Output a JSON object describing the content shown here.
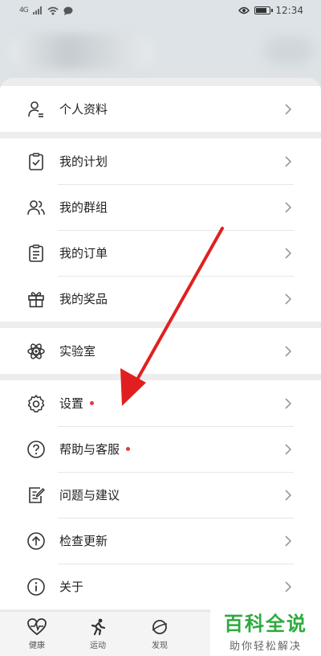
{
  "status_bar": {
    "signal_text": "4G",
    "time": "12:34",
    "icons": [
      "signal-icon",
      "wifi-icon",
      "message-icon",
      "eye-icon",
      "battery-icon"
    ]
  },
  "menu": {
    "group1": [
      {
        "label": "个人资料",
        "icon": "person-icon",
        "dot": false
      }
    ],
    "group2": [
      {
        "label": "我的计划",
        "icon": "clipboard-check-icon",
        "dot": false
      },
      {
        "label": "我的群组",
        "icon": "group-icon",
        "dot": false
      },
      {
        "label": "我的订单",
        "icon": "order-icon",
        "dot": false
      },
      {
        "label": "我的奖品",
        "icon": "gift-icon",
        "dot": false
      }
    ],
    "group3": [
      {
        "label": "实验室",
        "icon": "atom-icon",
        "dot": false
      }
    ],
    "group4": [
      {
        "label": "设置",
        "icon": "gear-icon",
        "dot": true
      },
      {
        "label": "帮助与客服",
        "icon": "help-icon",
        "dot": true
      },
      {
        "label": "问题与建议",
        "icon": "feedback-icon",
        "dot": false
      },
      {
        "label": "检查更新",
        "icon": "update-icon",
        "dot": false
      },
      {
        "label": "关于",
        "icon": "info-icon",
        "dot": false
      }
    ]
  },
  "tabs": [
    {
      "label": "健康",
      "icon": "heart-pulse-icon"
    },
    {
      "label": "运动",
      "icon": "runner-icon"
    },
    {
      "label": "发现",
      "icon": "planet-icon"
    }
  ],
  "watermark": {
    "title": "百科全说",
    "subtitle": "助你轻松解决"
  },
  "colors": {
    "accent_red": "#e23b3b",
    "watermark_green": "#2cab3c"
  }
}
